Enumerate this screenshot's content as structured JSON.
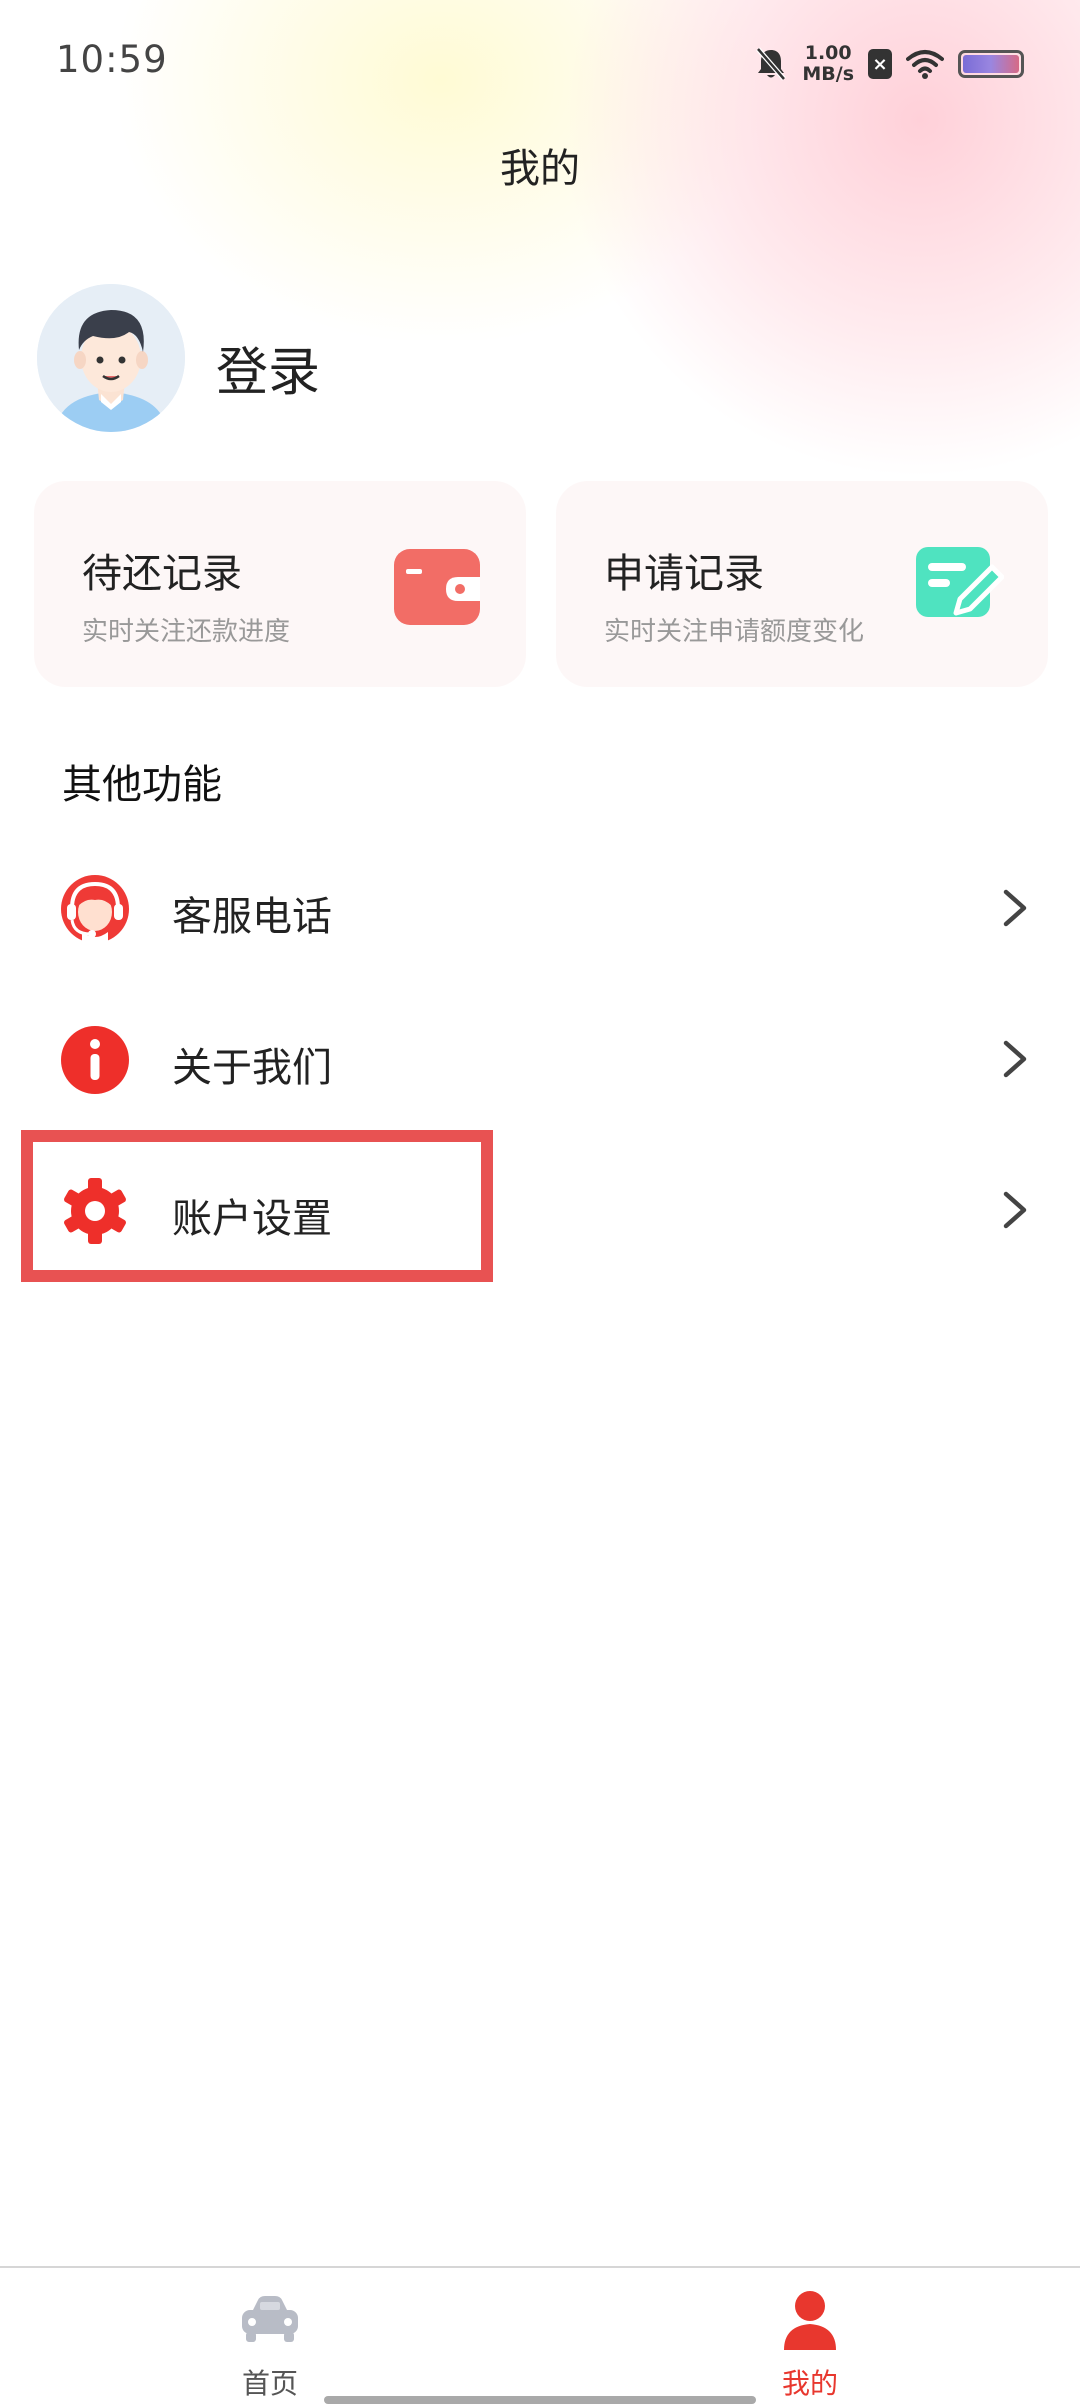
{
  "status_bar": {
    "time": "10:59",
    "net_speed_value": "1.00",
    "net_speed_unit": "MB/s",
    "sim_badge": "×",
    "icons": [
      "bell-muted-icon",
      "sim-disabled-icon",
      "wifi-icon",
      "battery-icon"
    ]
  },
  "header": {
    "title": "我的"
  },
  "profile": {
    "login_label": "登录",
    "avatar_icon": "user-avatar"
  },
  "cards": [
    {
      "title": "待还记录",
      "subtitle": "实时关注还款进度",
      "icon": "wallet-icon",
      "color": "#f26d66"
    },
    {
      "title": "申请记录",
      "subtitle": "实时关注申请额度变化",
      "icon": "edit-document-icon",
      "color": "#4fe3c0"
    }
  ],
  "section": {
    "title": "其他功能"
  },
  "menu": [
    {
      "label": "客服电话",
      "icon": "customer-service-headset-icon"
    },
    {
      "label": "关于我们",
      "icon": "info-icon"
    },
    {
      "label": "账户设置",
      "icon": "gear-icon"
    }
  ],
  "bottom_nav": [
    {
      "label": "首页",
      "icon": "car-icon",
      "active": false,
      "color": "#555555"
    },
    {
      "label": "我的",
      "icon": "person-icon",
      "active": true,
      "color": "#e8372e"
    }
  ],
  "colors": {
    "accent": "#e8372e",
    "highlight": "#e85252"
  }
}
